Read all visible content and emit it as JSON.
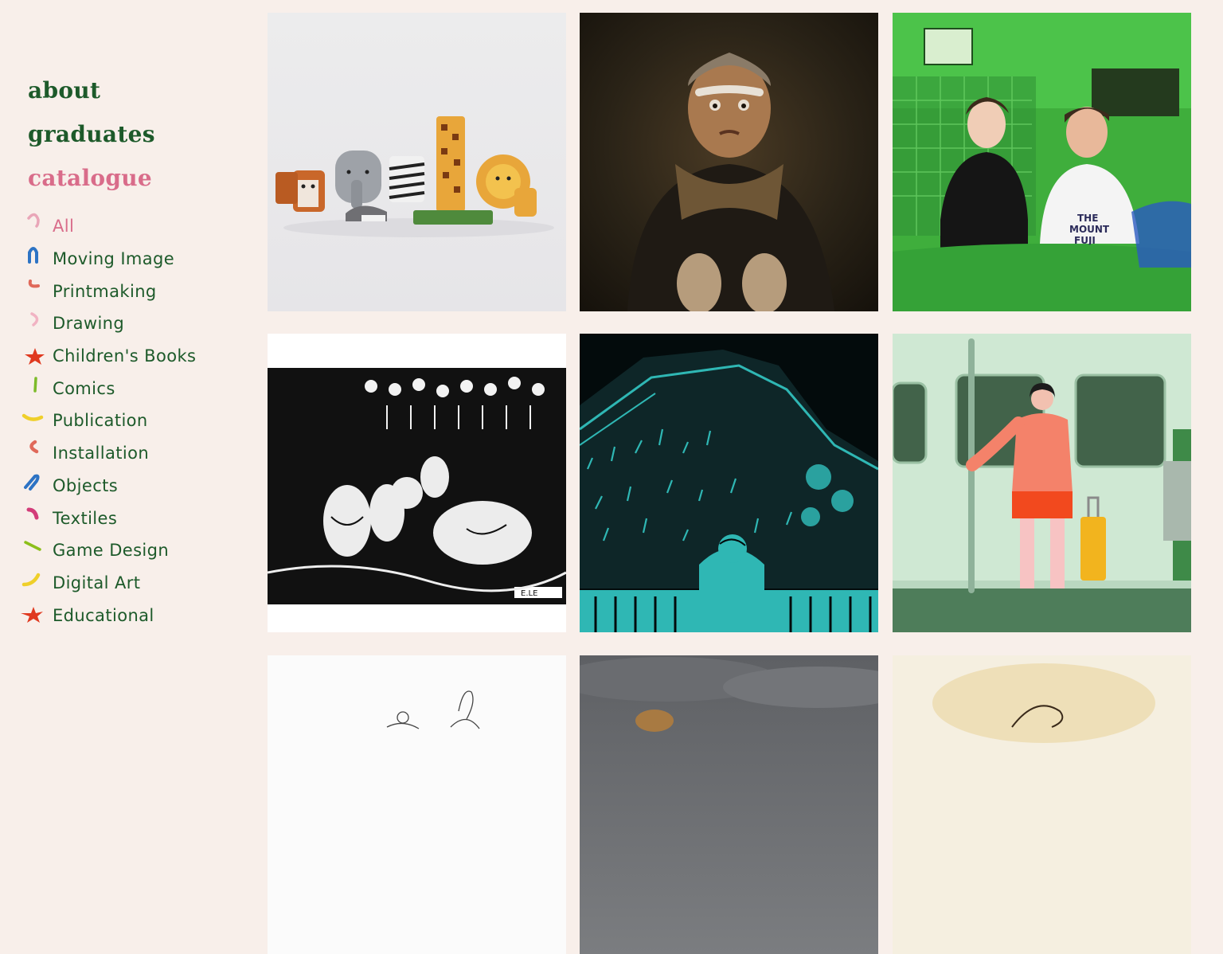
{
  "nav": {
    "about": "about",
    "graduates": "graduates",
    "catalogue": "catalogue"
  },
  "categories": [
    {
      "label": "All",
      "icon": "pink-arc-mark",
      "color": "#e9a6b8"
    },
    {
      "label": "Moving Image",
      "icon": "blue-arch-mark",
      "color": "#2d73c4"
    },
    {
      "label": "Printmaking",
      "icon": "coral-curve-mark",
      "color": "#e0695a"
    },
    {
      "label": "Drawing",
      "icon": "pink-bracket-mark",
      "color": "#f1b3c3"
    },
    {
      "label": "Children's Books",
      "icon": "red-star-mark",
      "color": "#e0391f"
    },
    {
      "label": "Comics",
      "icon": "green-line-mark",
      "color": "#7dbb2a"
    },
    {
      "label": "Publication",
      "icon": "yellow-smile-mark",
      "color": "#efcf2a"
    },
    {
      "label": "Installation",
      "icon": "coral-moon-mark",
      "color": "#e0695a"
    },
    {
      "label": "Objects",
      "icon": "blue-swoosh-mark",
      "color": "#2d73c4"
    },
    {
      "label": "Textiles",
      "icon": "magenta-leaf-mark",
      "color": "#d33c79"
    },
    {
      "label": "Game Design",
      "icon": "green-dash-mark",
      "color": "#8cbf1a"
    },
    {
      "label": "Digital Art",
      "icon": "yellow-check-mark",
      "color": "#efcf2a"
    },
    {
      "label": "Educational",
      "icon": "red-star-mark",
      "color": "#e0391f"
    }
  ],
  "tiles": [
    {
      "name": "wooden-animal-blocks-thumbnail",
      "alt": "wooden animal toy blocks"
    },
    {
      "name": "knitted-old-man-puppet-thumbnail",
      "alt": "knitted old man puppet"
    },
    {
      "name": "green-couple-drawing-thumbnail",
      "alt": "green couple portrait"
    },
    {
      "name": "picnic-linocut-thumbnail",
      "alt": "black and white picnic print"
    },
    {
      "name": "teal-night-river-thumbnail",
      "alt": "teal night river animation"
    },
    {
      "name": "subway-girl-illustration-thumbnail",
      "alt": "subway girl illustration"
    },
    {
      "name": "pencil-sketch-thumbnail",
      "alt": "pencil sketch"
    },
    {
      "name": "grey-sky-photo-thumbnail",
      "alt": "grey sky photo"
    },
    {
      "name": "watercolor-drawing-thumbnail",
      "alt": "watercolor drawing"
    }
  ]
}
